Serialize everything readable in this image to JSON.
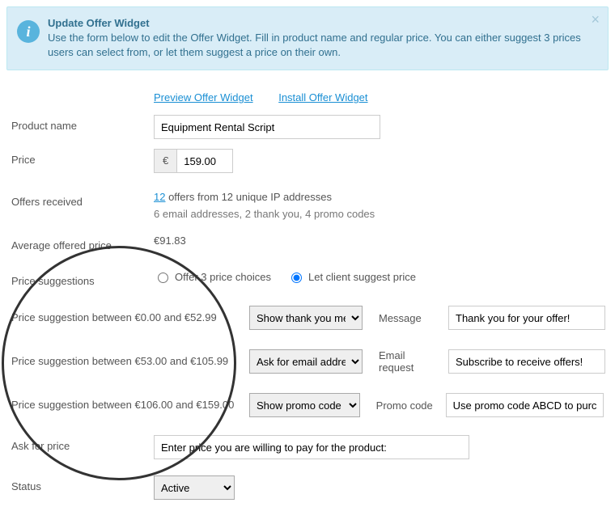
{
  "alert": {
    "title": "Update Offer Widget",
    "body": "Use the form below to edit the Offer Widget. Fill in product name and regular price. You can either suggest 3 prices users can select from, or let them suggest a price on their own.",
    "close": "×",
    "info_glyph": "i"
  },
  "links": {
    "preview": "Preview Offer Widget",
    "install": "Install Offer Widget"
  },
  "labels": {
    "product_name": "Product name",
    "price": "Price",
    "offers_received": "Offers received",
    "avg_price": "Average offered price",
    "price_suggestions": "Price suggestions",
    "ask_for_price": "Ask for price",
    "status": "Status"
  },
  "fields": {
    "product_name": "Equipment Rental Script",
    "currency": "€",
    "price": "159.00",
    "offers_line1_count": "12",
    "offers_line1_rest": " offers from 12 unique IP addresses",
    "offers_line2": "6 email addresses, 2 thank you, 4 promo codes",
    "avg_price": "€91.83",
    "ask_for_price_value": "Enter price you are willing to pay for the product:",
    "status_value": "Active"
  },
  "radios": {
    "opt1": "Offer 3 price choices",
    "opt2": "Let client suggest price"
  },
  "tiers": [
    {
      "label": "Price suggestion between €0.00 and €52.99",
      "action": "Show thank you message",
      "side_label": "Message",
      "side_value": "Thank you for your offer!"
    },
    {
      "label": "Price suggestion between €53.00 and €105.99",
      "action": "Ask for email address",
      "side_label": "Email request",
      "side_value": "Subscribe to receive offers!"
    },
    {
      "label": "Price suggestion between €106.00 and €159.00",
      "action": "Show promo code",
      "side_label": "Promo code",
      "side_value": "Use promo code ABCD to purchase"
    }
  ]
}
